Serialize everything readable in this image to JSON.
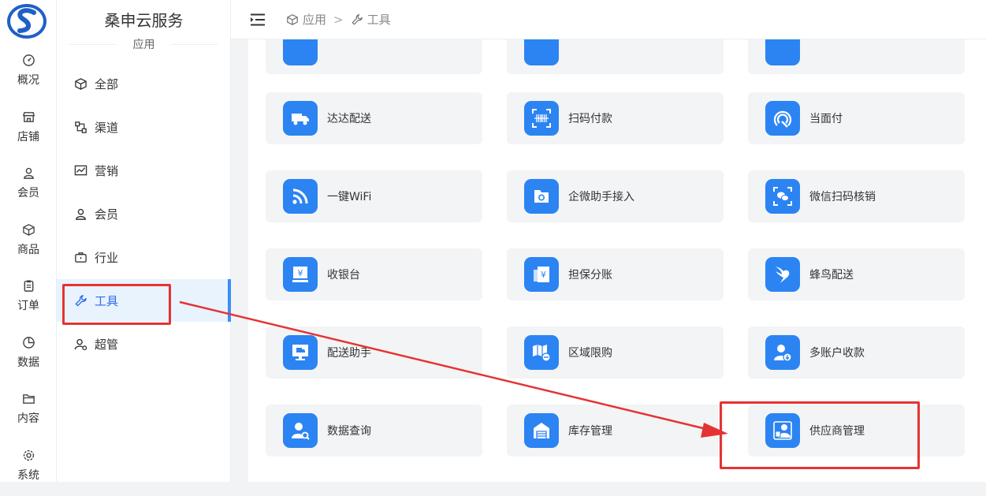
{
  "app": {
    "title": "桑申云服务",
    "subtitle": "应用"
  },
  "rail": [
    {
      "label": "概况",
      "icon": "dashboard-icon"
    },
    {
      "label": "店铺",
      "icon": "store-icon"
    },
    {
      "label": "会员",
      "icon": "user-icon"
    },
    {
      "label": "商品",
      "icon": "box-icon"
    },
    {
      "label": "订单",
      "icon": "clipboard-icon"
    },
    {
      "label": "数据",
      "icon": "pie-icon"
    },
    {
      "label": "内容",
      "icon": "folder-icon"
    },
    {
      "label": "系统",
      "icon": "gear-icon"
    }
  ],
  "nav": [
    {
      "label": "全部",
      "icon": "cube-icon"
    },
    {
      "label": "渠道",
      "icon": "channel-icon"
    },
    {
      "label": "营销",
      "icon": "chart-icon"
    },
    {
      "label": "会员",
      "icon": "user-icon"
    },
    {
      "label": "行业",
      "icon": "briefcase-icon"
    },
    {
      "label": "工具",
      "icon": "wrench-icon",
      "active": true
    },
    {
      "label": "超管",
      "icon": "admin-icon"
    }
  ],
  "breadcrumb": {
    "root": "应用",
    "separator": ">",
    "current": "工具"
  },
  "cards": [
    {
      "label": "达达配送",
      "icon": "truck-icon"
    },
    {
      "label": "扫码付款",
      "icon": "barcode-scan-icon"
    },
    {
      "label": "当面付",
      "icon": "alipay-icon"
    },
    {
      "label": "一键WiFi",
      "icon": "wifi-icon"
    },
    {
      "label": "企微助手接入",
      "icon": "wecom-folder-icon"
    },
    {
      "label": "微信扫码核销",
      "icon": "wechat-scan-icon"
    },
    {
      "label": "收银台",
      "icon": "cashier-icon"
    },
    {
      "label": "担保分账",
      "icon": "guarantee-split-icon"
    },
    {
      "label": "蜂鸟配送",
      "icon": "hummingbird-icon"
    },
    {
      "label": "配送助手",
      "icon": "delivery-monitor-icon"
    },
    {
      "label": "区域限购",
      "icon": "map-limit-icon"
    },
    {
      "label": "多账户收款",
      "icon": "multi-account-icon"
    },
    {
      "label": "数据查询",
      "icon": "data-search-icon"
    },
    {
      "label": "库存管理",
      "icon": "warehouse-icon"
    },
    {
      "label": "供应商管理",
      "icon": "supplier-icon"
    }
  ],
  "colors": {
    "accent": "#2b84f2",
    "active_bg": "#e8f3fe",
    "annotation": "#e63232"
  }
}
